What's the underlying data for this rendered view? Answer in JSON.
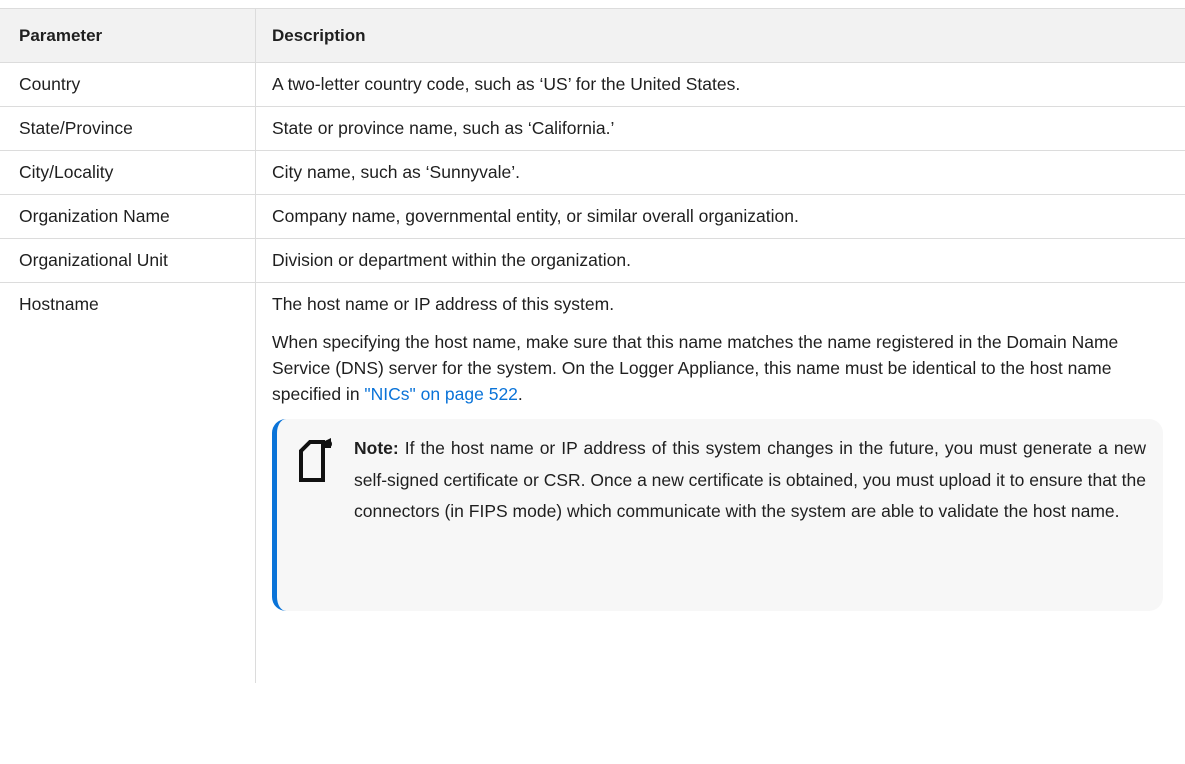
{
  "table": {
    "headers": {
      "parameter": "Parameter",
      "description": "Description"
    },
    "rows": [
      {
        "parameter": "Country",
        "description": "A two-letter country code, such as ‘US’ for the United States."
      },
      {
        "parameter": "State/Province",
        "description": "State or province name, such as ‘California.’"
      },
      {
        "parameter": "City/Locality",
        "description": "City name, such as ‘Sunnyvale’."
      },
      {
        "parameter": "Organization Name",
        "description": "Company name, governmental entity, or similar overall organization."
      },
      {
        "parameter": "Organizational Unit",
        "description": "Division or department within the organization."
      }
    ],
    "hostname": {
      "parameter": "Hostname",
      "line1": "The host name or IP address of this system.",
      "para2": "When specifying the host name, make sure that this name matches the name registered in the Domain Name Service (DNS) server for the system. On the Logger Appliance, this name must be identical to the host name specified in ",
      "link": "\"NICs\" on page 522",
      "para2_end": ".",
      "note": {
        "icon": "note-icon",
        "label": "Note:",
        "text": " If the host name or IP address of this system changes in the future, you must generate a new self-signed certificate or CSR. Once a new certificate is obtained, you must upload it to ensure that the connectors (in FIPS mode) which communicate with the system are able to validate the host name."
      }
    }
  },
  "colors": {
    "link": "#0a73d8",
    "note_accent": "#0a73d8",
    "header_bg": "#f2f2f2"
  }
}
